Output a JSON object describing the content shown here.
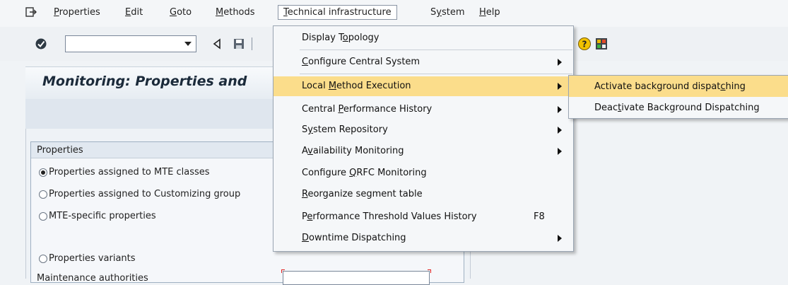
{
  "menubar": {
    "items": [
      {
        "pre": "",
        "u": "P",
        "post": "roperties"
      },
      {
        "pre": "",
        "u": "E",
        "post": "dit"
      },
      {
        "pre": "",
        "u": "G",
        "post": "oto"
      },
      {
        "pre": "",
        "u": "M",
        "post": "ethods"
      },
      {
        "pre": "",
        "u": "T",
        "post": "echnical infrastructure"
      },
      {
        "pre": "S",
        "u": "y",
        "post": "stem"
      },
      {
        "pre": "",
        "u": "H",
        "post": "elp"
      }
    ]
  },
  "toolbar": {
    "command_value": "",
    "icons": [
      "check-icon",
      "dropdown-icon",
      "back-icon",
      "save-icon",
      "help-icon",
      "layout-icon"
    ]
  },
  "screen": {
    "title": "Monitoring: Properties and"
  },
  "properties_group": {
    "title": "Properties",
    "options": [
      {
        "label": "Properties assigned to MTE classes",
        "checked": true
      },
      {
        "label": "Properties assigned to Customizing group",
        "checked": false
      },
      {
        "label": "MTE-specific properties",
        "checked": false
      },
      {
        "label": "Properties variants",
        "checked": false
      }
    ],
    "partial_label": "Maintenance authorities"
  },
  "dropdown_menu": {
    "items": [
      {
        "pre": "Display T",
        "u": "o",
        "post": "pology",
        "shortcut": "",
        "submenu": false
      },
      {
        "pre": "",
        "u": "C",
        "post": "onfigure Central System",
        "shortcut": "",
        "submenu": true
      },
      {
        "pre": "Local ",
        "u": "M",
        "post": "ethod Execution",
        "shortcut": "",
        "submenu": true
      },
      {
        "pre": "Central ",
        "u": "P",
        "post": "erformance History",
        "shortcut": "",
        "submenu": true
      },
      {
        "pre": "S",
        "u": "y",
        "post": "stem Repository",
        "shortcut": "",
        "submenu": true
      },
      {
        "pre": "A",
        "u": "v",
        "post": "ailability Monitoring",
        "shortcut": "",
        "submenu": true
      },
      {
        "pre": "Configure ",
        "u": "Q",
        "post": "RFC Monitoring",
        "shortcut": "",
        "submenu": false
      },
      {
        "pre": "",
        "u": "R",
        "post": "eorganize segment table",
        "shortcut": "",
        "submenu": false
      },
      {
        "pre": "P",
        "u": "e",
        "post": "rformance Threshold Values History",
        "shortcut": "F8",
        "submenu": false
      },
      {
        "pre": "",
        "u": "D",
        "post": "owntime Dispatching",
        "shortcut": "",
        "submenu": true
      }
    ],
    "highlighted_index": 2
  },
  "submenu": {
    "items": [
      {
        "pre": "Activate background dispat",
        "u": "c",
        "post": "hing"
      },
      {
        "pre": "Deac",
        "u": "t",
        "post": "ivate Background Dispatching"
      }
    ],
    "highlighted_index": 0
  },
  "colors": {
    "highlight": "#fbdd8b",
    "background": "#f0f3f6",
    "required_marker": "#e02020"
  }
}
